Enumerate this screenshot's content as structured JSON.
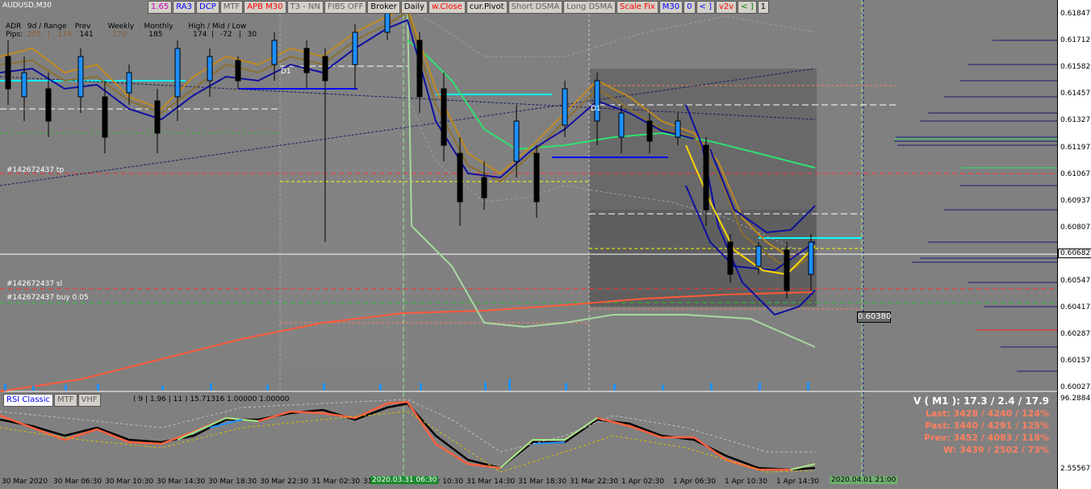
{
  "symbol": "AUDUSD,M30",
  "toolbar": [
    {
      "label": "1.65",
      "color": "#c000c0"
    },
    {
      "label": "RA3",
      "color": "#0000ff"
    },
    {
      "label": "DCP",
      "color": "#0000ff"
    },
    {
      "label": "MTF",
      "color": "#606060"
    },
    {
      "label": "APB M30",
      "color": "#ff0000"
    },
    {
      "label": "T3 - NN",
      "color": "#606060"
    },
    {
      "label": "FIBS OFF",
      "color": "#606060"
    },
    {
      "label": "Broker",
      "color": "#000000"
    },
    {
      "label": "Daily",
      "color": "#000000"
    },
    {
      "label": "w.Close",
      "color": "#ff0000"
    },
    {
      "label": "cur.Pivot",
      "color": "#000000"
    },
    {
      "label": "Short DSMA",
      "color": "#606060"
    },
    {
      "label": "Long DSMA",
      "color": "#606060"
    },
    {
      "label": "Scale Fix",
      "color": "#ff0000"
    },
    {
      "label": "M30",
      "color": "#0000ff"
    },
    {
      "label": "0",
      "color": "#0000ff"
    },
    {
      "label": "< ]",
      "color": "#0000ff"
    },
    {
      "label": "v2v",
      "color": "#ff0000"
    },
    {
      "label": "< ]",
      "color": "#008000"
    },
    {
      "label": "1",
      "color": "#000000"
    }
  ],
  "adr": {
    "headers": [
      "ADR",
      "9d / Range",
      "Prev",
      "Weekly",
      "Monthly",
      "High / Mid / Low"
    ],
    "row_label": "Pips:",
    "values": [
      "205",
      "119",
      "141",
      "170",
      "185",
      "174",
      "-72",
      "30"
    ]
  },
  "order_labels": {
    "tp": "#142672437 tp",
    "sl": "#142672437 sl",
    "buy": "#142672437 buy 0.05"
  },
  "d1_label": "D1",
  "price_axis": [
    "0.61847",
    "0.61712",
    "0.61582",
    "0.61457",
    "0.61327",
    "0.61197",
    "0.61067",
    "0.60937",
    "0.60807",
    "0.60547",
    "0.60417",
    "0.60287",
    "0.60157",
    "0.60027"
  ],
  "current_price": "0.60682",
  "price_box": "0.60380",
  "rsi": {
    "tabs": [
      "RSI Classic",
      "MTF",
      "VHF"
    ],
    "params": "( 9 | 1.96 | 11 ) 15.71316 1.00000 1.00000",
    "axis_top": "96.28845",
    "axis_bottom": "2.55567"
  },
  "stats": {
    "v": "V ( M1 ): 17.3 / 2.4 / 17.9",
    "last": "Last: 3428 / 4240 / 124%",
    "past": "Past: 3440 / 4291 / 125%",
    "prev": "Prev: 3452 / 4083 / 118%",
    "w": "W: 3439 / 2502 / 73%"
  },
  "time_axis": [
    "30 Mar 2020",
    "30 Mar 06:30",
    "30 Mar 10:30",
    "30 Mar 14:30",
    "30 Mar 18:30",
    "30 Mar 22:30",
    "31 Mar 02:30",
    "31 Mar 06:30",
    "31 Mar 10:30",
    "31 Mar 14:30",
    "31 Mar 18:30",
    "31 Mar 22:30",
    "1 Apr 02:30",
    "1 Apr 06:30",
    "1 Apr 10:30",
    "1 Apr 14:30"
  ],
  "time_highlight": "2020.03.31 06:30",
  "time_highlight2": "2020.04.01 21:00"
}
